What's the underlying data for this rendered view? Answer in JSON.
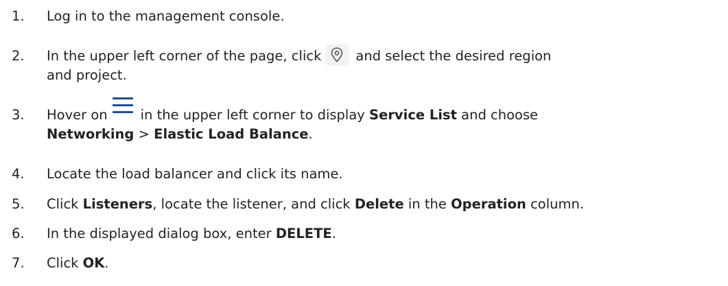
{
  "steps": [
    {
      "num": "1.",
      "text": "Log in to the management console."
    },
    {
      "num": "2.",
      "before": "In the upper left corner of the page, click",
      "icon": "location-pin-icon",
      "after": "and select the desired region",
      "line2": "and project."
    },
    {
      "num": "3.",
      "before": "Hover on",
      "icon": "hamburger-menu-icon",
      "after": "in the upper left corner to display",
      "b1": "Service List",
      "after2": "and choose",
      "line2_b1": "Networking",
      "line2_sep": " > ",
      "line2_b2": "Elastic Load Balance",
      "line2_end": "."
    },
    {
      "num": "4.",
      "text": "Locate the load balancer and click its name."
    },
    {
      "num": "5.",
      "t1": "Click ",
      "b1": "Listeners",
      "t2": ", locate the listener, and click ",
      "b2": "Delete",
      "t3": " in the ",
      "b3": "Operation",
      "t4": " column."
    },
    {
      "num": "6.",
      "t1": "In the displayed dialog box, enter ",
      "b1": "DELETE",
      "t2": "."
    },
    {
      "num": "7.",
      "t1": "Click ",
      "b1": "OK",
      "t2": "."
    }
  ],
  "colors": {
    "text": "#222222",
    "icon": "#555555",
    "menu_icon": "#1f4e8c"
  }
}
